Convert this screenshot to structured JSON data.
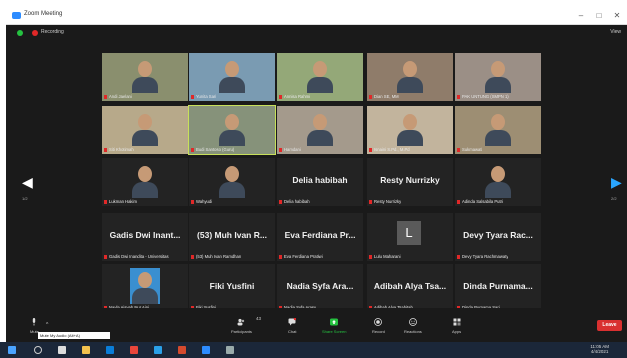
{
  "window": {
    "title": "Zoom Meeting"
  },
  "topbar": {
    "recording": "Recording",
    "view": "View"
  },
  "pager": {
    "left": "1/2",
    "right": "2/2"
  },
  "tiles": [
    {
      "label": "Andi Jaelani",
      "big": ""
    },
    {
      "label": "Yunita Sari",
      "big": ""
    },
    {
      "label": "Annisa Rahmi",
      "big": ""
    },
    {
      "label": "Dian SE, MM",
      "big": ""
    },
    {
      "label": "PAK UNTUNG (SMPN 1)",
      "big": ""
    },
    {
      "label": "Siti Khotimah",
      "big": ""
    },
    {
      "label": "Budi Santoso (Guru)",
      "big": ""
    },
    {
      "label": "Hamdani",
      "big": ""
    },
    {
      "label": "Isnaini S.Pd., M.Pd",
      "big": ""
    },
    {
      "label": "Sukmawati",
      "big": ""
    },
    {
      "label": "Lukman Hakim",
      "big": ""
    },
    {
      "label": "Wahyudi",
      "big": ""
    },
    {
      "label": "Delia habibah",
      "big": "Delia habibah"
    },
    {
      "label": "Resty Nurrizky",
      "big": "Resty Nurrizky"
    },
    {
      "label": "Adinda Salsabila Putri",
      "big": ""
    },
    {
      "label": "Gadis Dwi Inandita - Universitas",
      "big": "Gadis Dwi Inant..."
    },
    {
      "label": "(53) Muh Ivan Ramdhan",
      "big": "(53) Muh Ivan R..."
    },
    {
      "label": "Eva Ferdiana Pratiwi",
      "big": "Eva Ferdiana Pr..."
    },
    {
      "label": "Lulu Maharani",
      "big": ""
    },
    {
      "label": "Devy Tyara Rachmawaty",
      "big": "Devy Tyara Rac..."
    },
    {
      "label": "Nayla Aisyah Nur Aini",
      "big": ""
    },
    {
      "label": "Fiki Yusfini",
      "big": "Fiki Yusfini"
    },
    {
      "label": "Nadia Syfa Arasy",
      "big": "Nadia Syfa Ara..."
    },
    {
      "label": "Adibah Alya Tsabitah",
      "big": "Adibah Alya Tsa..."
    },
    {
      "label": "Dinda Purnama Sari",
      "big": "Dinda Purnama..."
    }
  ],
  "toolbar": {
    "mute": "Mute",
    "tooltip": "Mute My Audio (Alt+A)",
    "participants": "Participants",
    "participants_count": "43",
    "chat": "Chat",
    "share": "Share Screen",
    "record": "Record",
    "reactions": "Reactions",
    "apps": "Apps",
    "leave": "Leave"
  },
  "taskbar": {
    "time": "11:05 AM",
    "date": "4/4/2021"
  },
  "colors": {
    "share": "#25c240",
    "leave": "#d93030",
    "accent": "#2d8cff"
  }
}
